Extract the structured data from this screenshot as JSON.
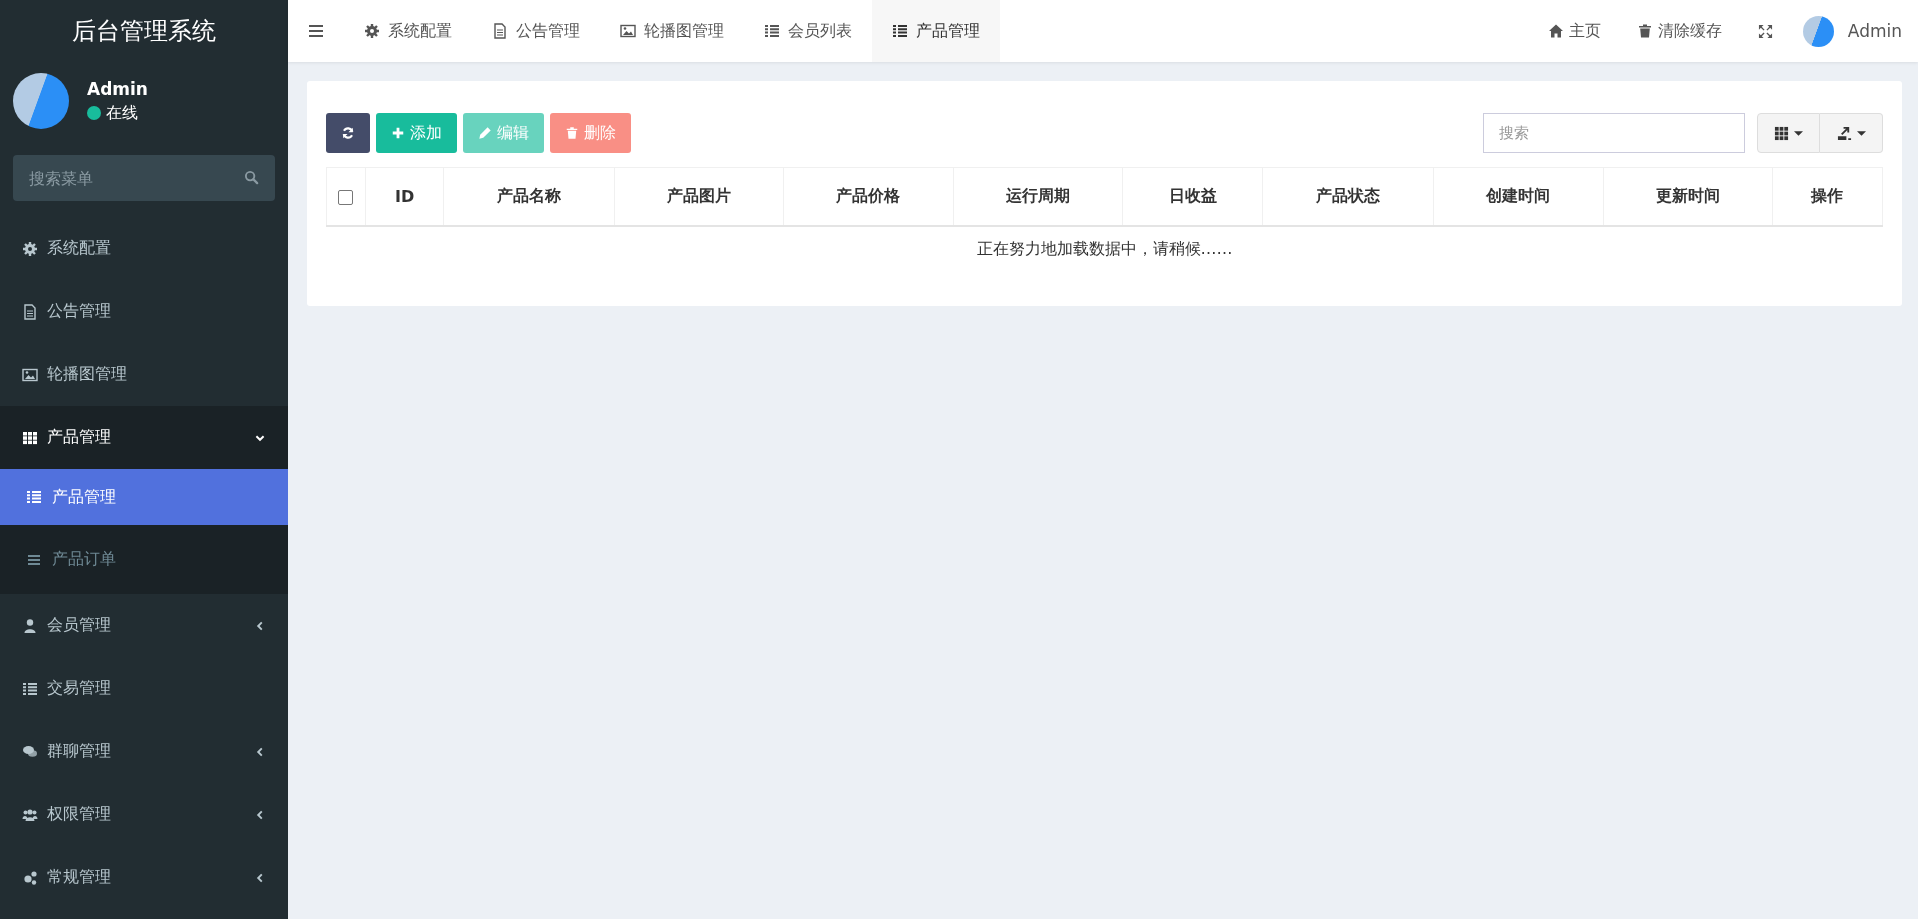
{
  "sidebar": {
    "logo": "后台管理系统",
    "user": {
      "name": "Admin",
      "status": "在线",
      "online": true
    },
    "search": {
      "placeholder": "搜索菜单"
    },
    "items": [
      {
        "label": "系统配置"
      },
      {
        "label": "公告管理"
      },
      {
        "label": "轮播图管理"
      },
      {
        "label": "产品管理",
        "expanded": true,
        "children": [
          {
            "label": "产品管理",
            "selected": true
          },
          {
            "label": "产品订单",
            "selected": false
          }
        ]
      },
      {
        "label": "会员管理",
        "expanded": false
      },
      {
        "label": "交易管理"
      },
      {
        "label": "群聊管理",
        "expanded": false
      },
      {
        "label": "权限管理",
        "expanded": false
      },
      {
        "label": "常规管理",
        "expanded": false
      }
    ]
  },
  "topbar": {
    "tabs": [
      {
        "label": "系统配置",
        "selected": false
      },
      {
        "label": "公告管理",
        "selected": false
      },
      {
        "label": "轮播图管理",
        "selected": false
      },
      {
        "label": "会员列表",
        "selected": false
      },
      {
        "label": "产品管理",
        "selected": true
      }
    ],
    "links": [
      {
        "label": "主页"
      },
      {
        "label": "清除缓存"
      }
    ],
    "user": "Admin"
  },
  "toolbar": {
    "buttons": [
      {
        "kind": "refresh"
      },
      {
        "kind": "add",
        "label": "添加",
        "disabled": false
      },
      {
        "kind": "edit",
        "label": "编辑",
        "disabled": true
      },
      {
        "kind": "delete",
        "label": "删除",
        "disabled": true
      }
    ],
    "search": {
      "placeholder": "搜索"
    }
  },
  "table": {
    "select_all": {
      "checked": false
    },
    "columns": [
      "ID",
      "产品名称",
      "产品图片",
      "产品价格",
      "运行周期",
      "日收益",
      "产品状态",
      "创建时间",
      "更新时间",
      "操作"
    ],
    "empty_message": "正在努力地加载数据中，请稍候……"
  }
}
